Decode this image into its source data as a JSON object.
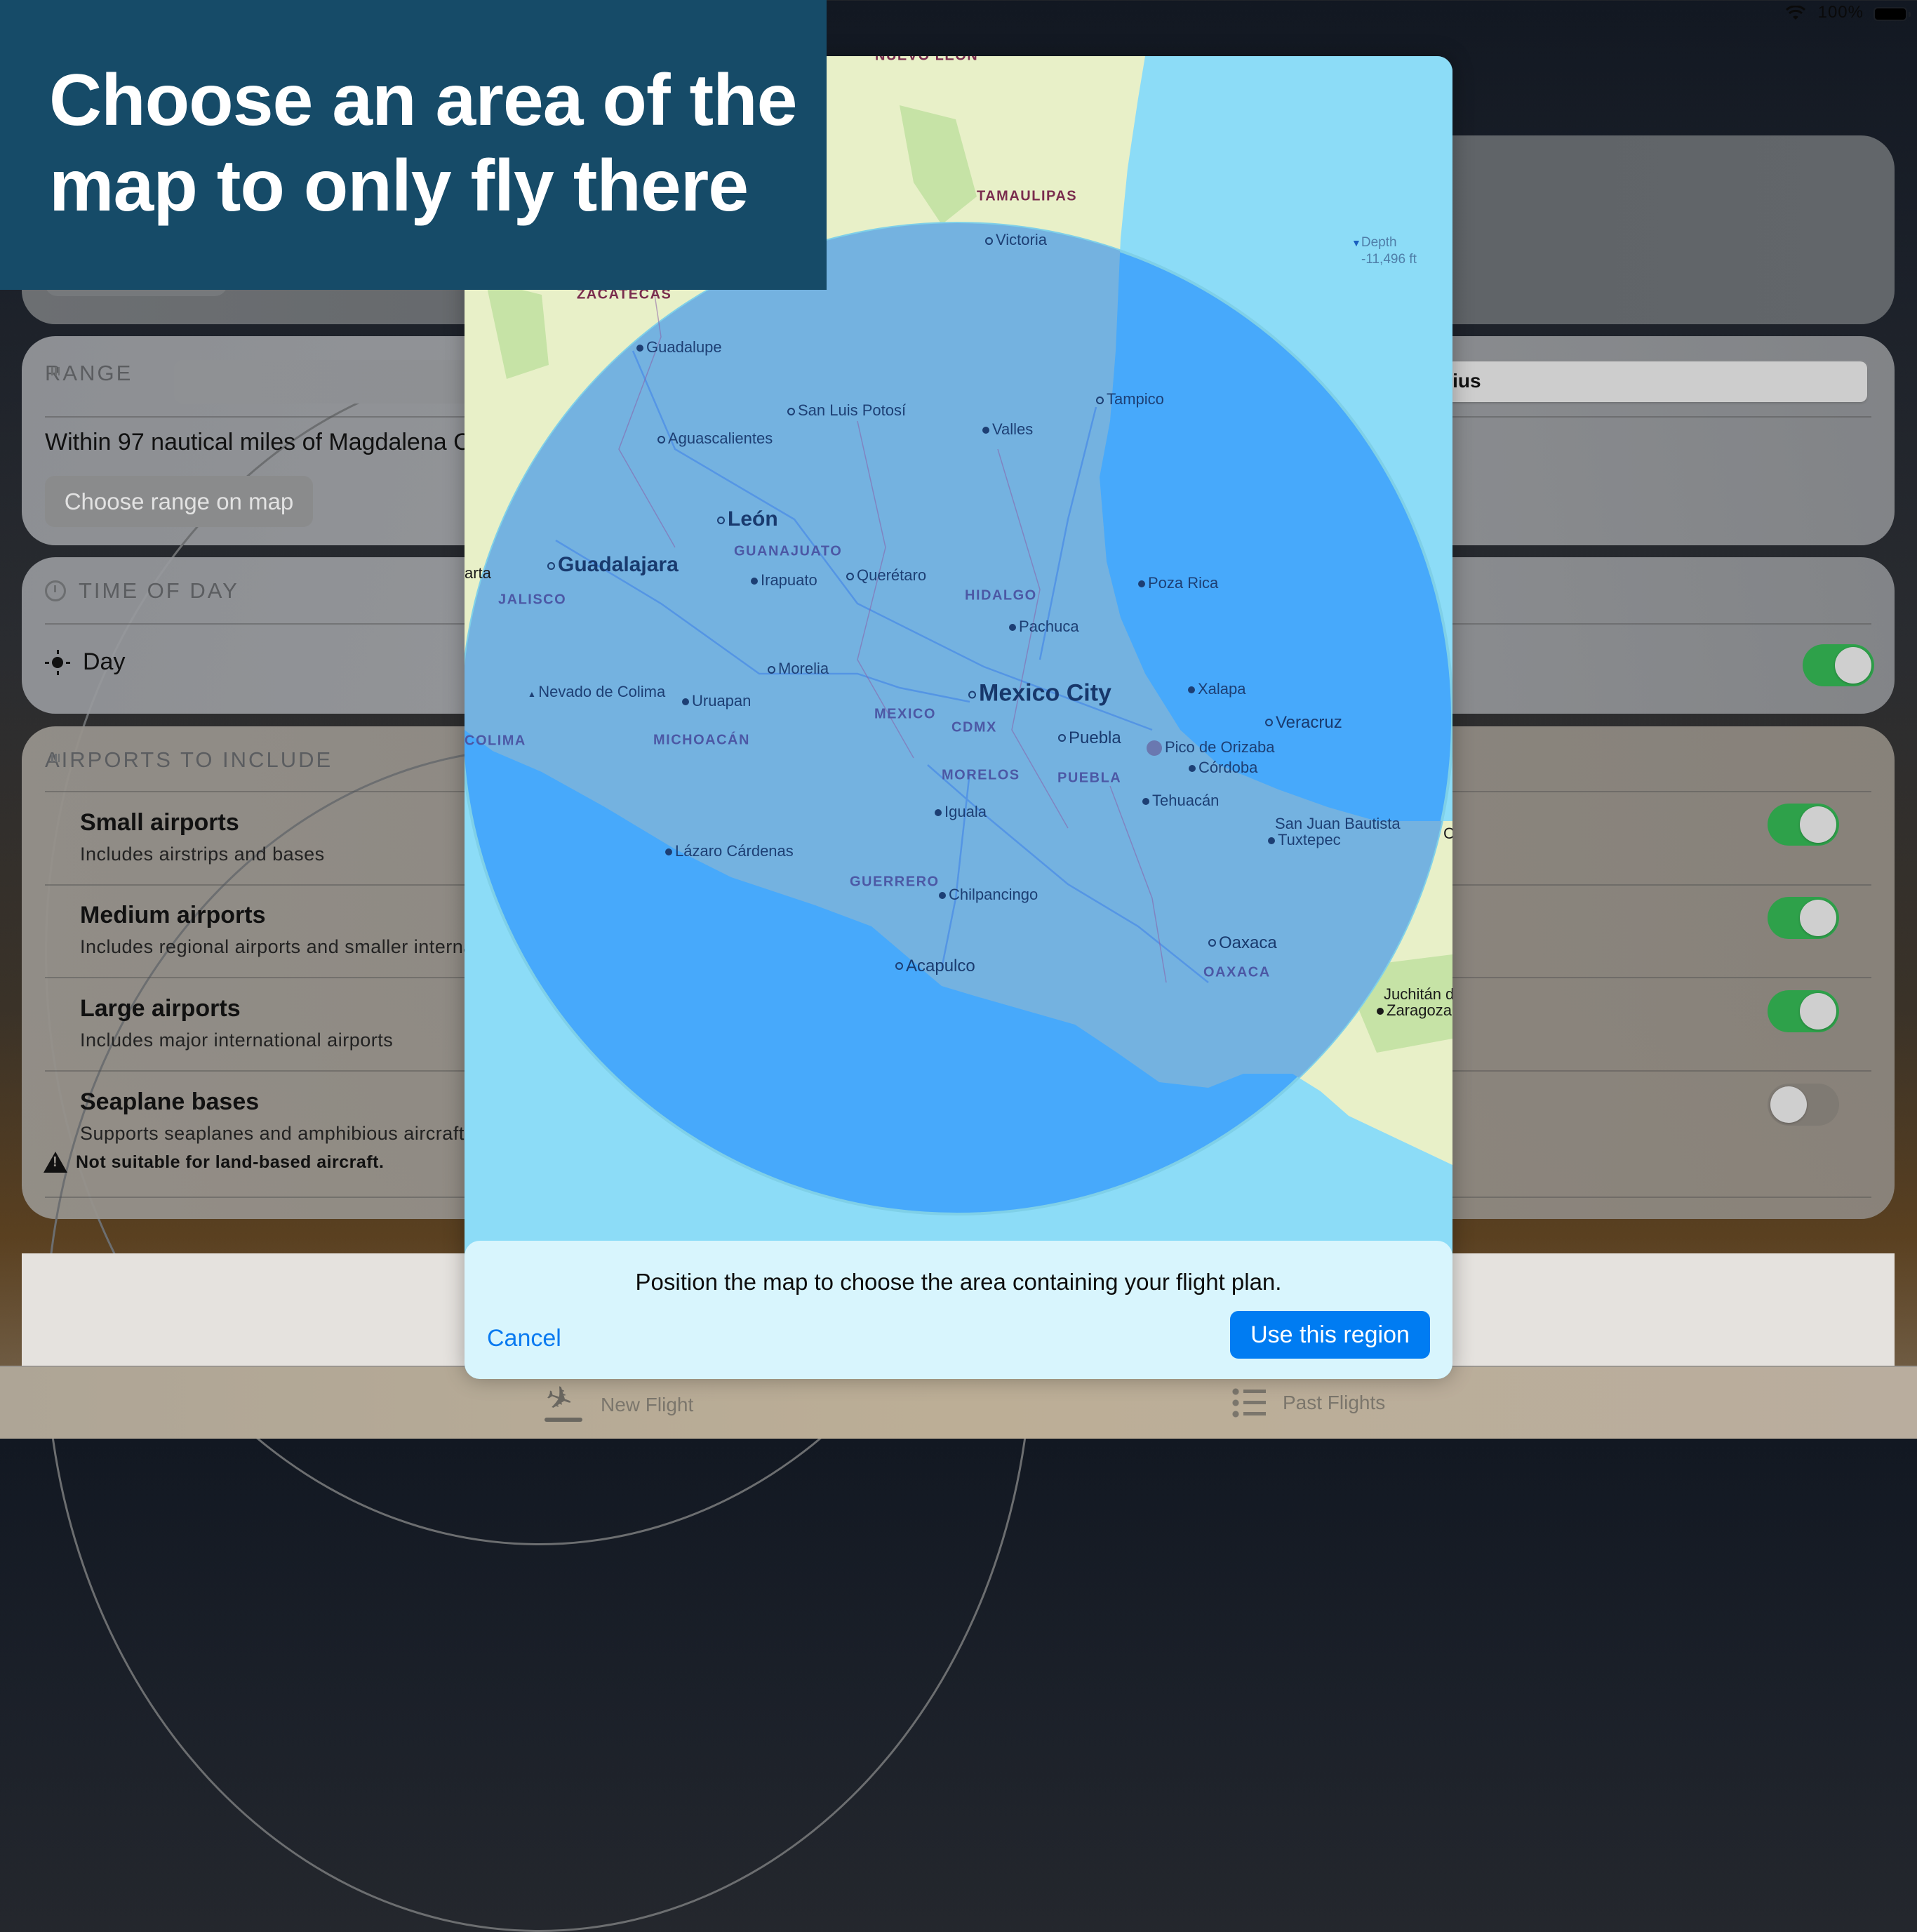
{
  "status_bar": {
    "battery_text": "100%",
    "wifi_icon": "wifi-icon",
    "battery_icon": "battery-icon"
  },
  "banner": {
    "line1": "Choose an area of the",
    "line2": "map to only fly there"
  },
  "range_section": {
    "header": "RANGE",
    "icon": "map-icon",
    "segment_selected_label": "Radius",
    "segment_visible_fragment": "dius",
    "description": "Within 97 nautical miles of Magdalena C",
    "choose_button": "Choose range on map"
  },
  "time_section": {
    "header": "TIME OF DAY",
    "icon": "clock-icon",
    "option_label": "Day",
    "option_icon": "sun-icon",
    "enabled": true
  },
  "airports_section": {
    "header": "AIRPORTS TO INCLUDE",
    "icon": "map-icon",
    "items": [
      {
        "title": "Small airports",
        "subtitle": "Includes airstrips and bases",
        "enabled": true
      },
      {
        "title": "Medium airports",
        "subtitle": "Includes regional airports and smaller internat",
        "enabled": true
      },
      {
        "title": "Large airports",
        "subtitle": "Includes major international airports",
        "enabled": true
      },
      {
        "title": "Seaplane bases",
        "subtitle": "Supports seaplanes and amphibious aircraft",
        "enabled": false,
        "warning": "Not suitable for land-based aircraft.",
        "warning_icon": "warning-icon"
      }
    ]
  },
  "map": {
    "depth_label": "Depth",
    "depth_value": "-11,496 ft",
    "colors": {
      "ocean": "#8cdcf7",
      "land": "#e8f0c8",
      "region_fill": "#47a9fb",
      "region_land": "#74b2e0"
    },
    "labels": {
      "nuevo_leon": "NUEVO LEÓN",
      "tamaulipas": "TAMAULIPAS",
      "zacatecas": "ZACATECAS",
      "victoria": "Victoria",
      "guadalupe": "Guadalupe",
      "san_luis_potosi": "San Luis Potosí",
      "tampico": "Tampico",
      "valles": "Valles",
      "aguascalientes": "Aguascalientes",
      "leon": "León",
      "guanajuato": "GUANAJUATO",
      "irapuato": "Irapuato",
      "queretaro": "Querétaro",
      "guadalajara": "Guadalajara",
      "jalisco": "JALISCO",
      "puerto_vallarta": "arta",
      "hidalgo": "HIDALGO",
      "poza_rica": "Poza Rica",
      "pachuca": "Pachuca",
      "morelia": "Morelia",
      "nevado": "Nevado de Colima",
      "uruapan": "Uruapan",
      "mexico_city": "Mexico City",
      "mexico_state": "MEXICO",
      "cdmx": "CDMX",
      "xalapa": "Xalapa",
      "veracruz": "Veracruz",
      "puebla_city": "Puebla",
      "pico": "Pico de Orizaba",
      "cordoba": "Córdoba",
      "colima": "COLIMA",
      "michoacan": "MICHOACÁN",
      "morelos": "MORELOS",
      "puebla_state": "PUEBLA",
      "tehuacan": "Tehuacán",
      "iguala": "Iguala",
      "san_juan": "San Juan Bautista",
      "tuxtepec": "Tuxtepec",
      "lazaro": "Lázaro Cárdenas",
      "guerrero": "GUERRERO",
      "chilpancingo": "Chilpancingo",
      "oaxaca_city": "Oaxaca",
      "oaxaca_state": "OAXACA",
      "acapulco": "Acapulco",
      "juchitan": "Juchitán d",
      "zaragoza": "Zaragoza",
      "coatz": "C"
    }
  },
  "modal_footer": {
    "message": "Position the map to choose the area containing your flight plan.",
    "cancel_label": "Cancel",
    "confirm_label": "Use this region",
    "accent": "#007cf2"
  },
  "tab_bar": {
    "tabs": [
      {
        "label": "New Flight",
        "icon": "airplane-departure-icon"
      },
      {
        "label": "Past Flights",
        "icon": "list-icon"
      }
    ]
  }
}
